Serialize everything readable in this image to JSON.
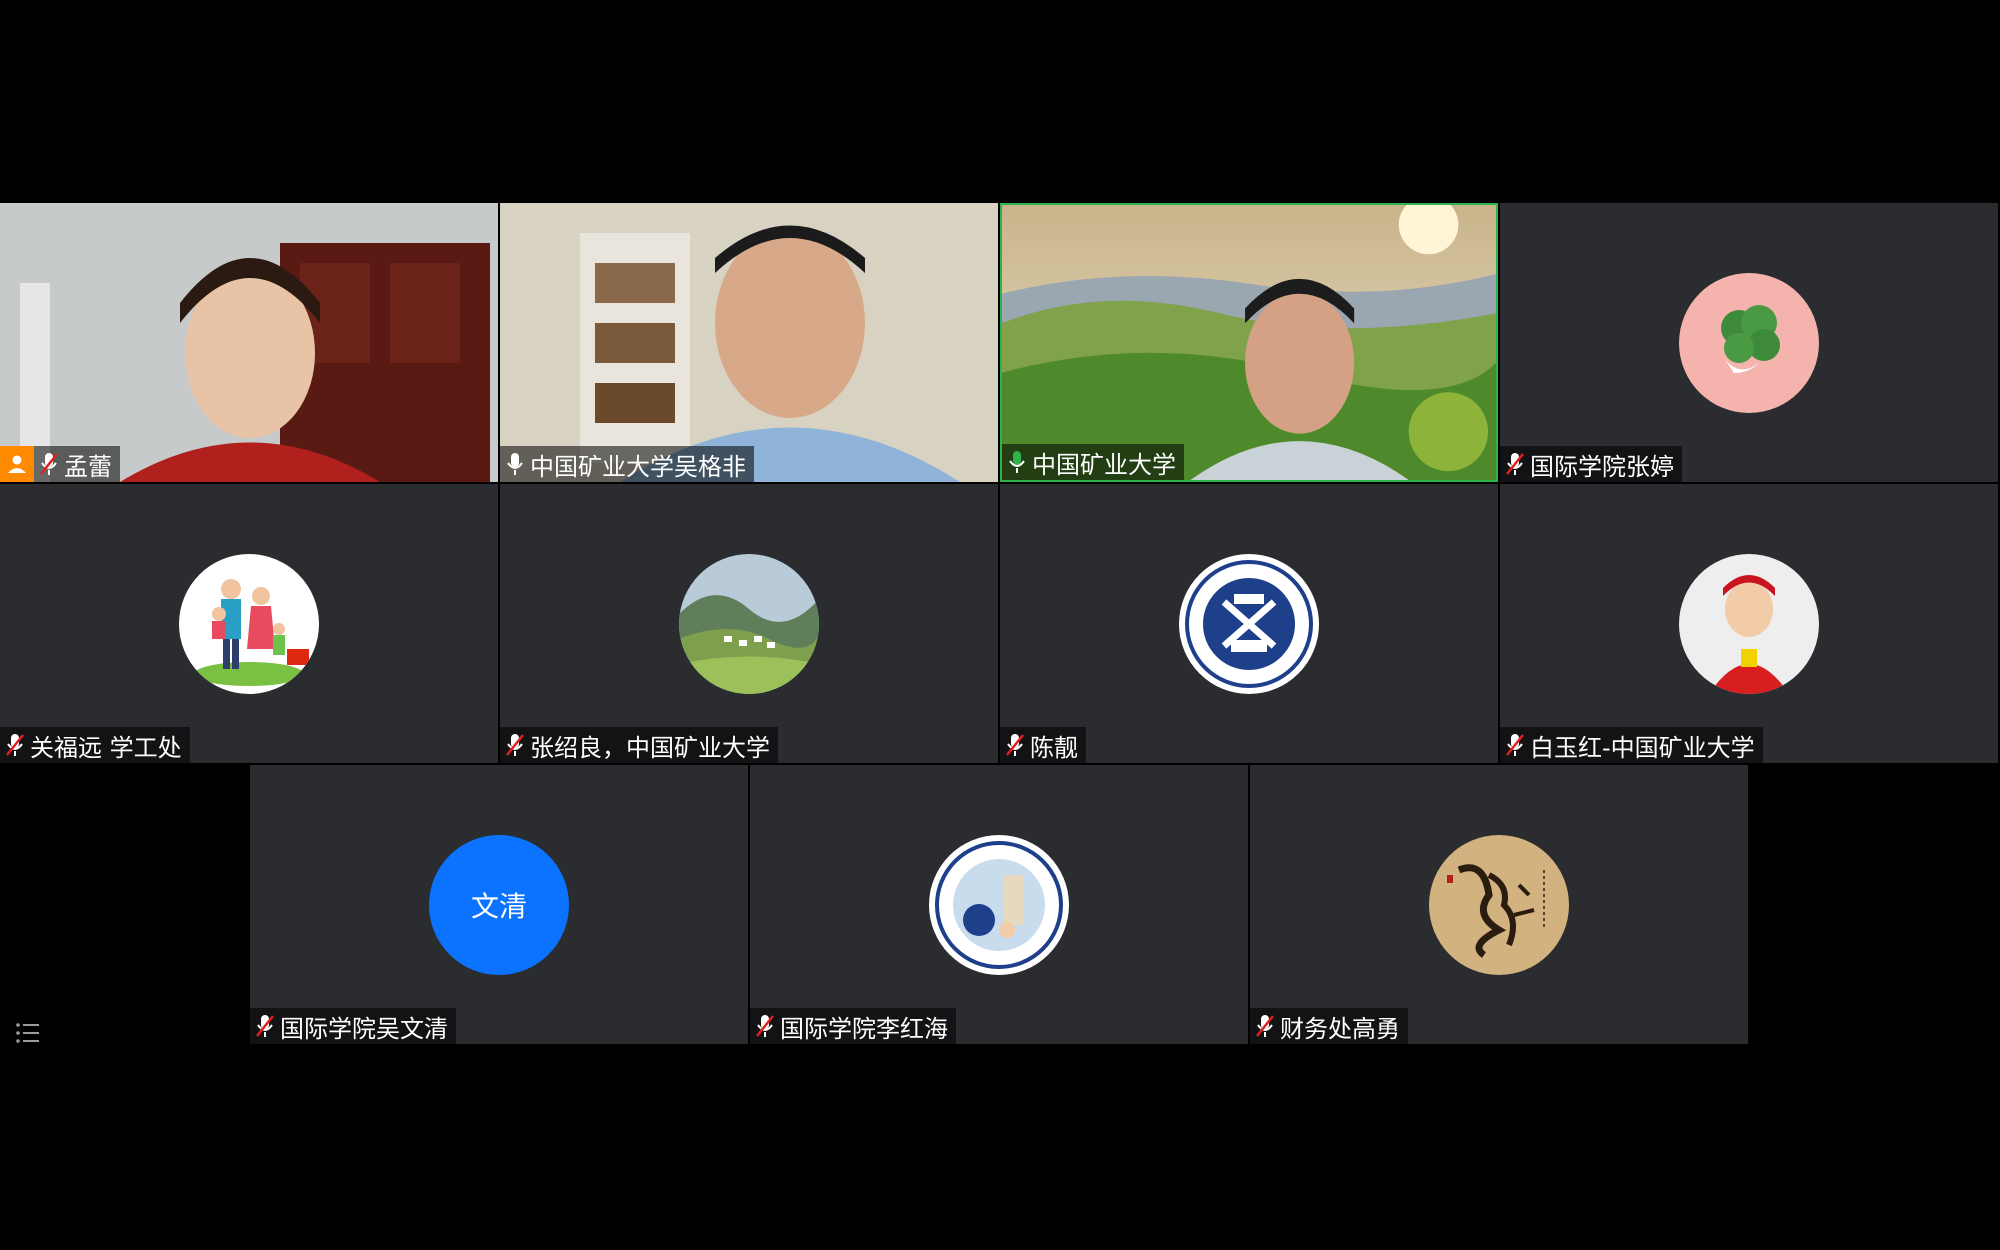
{
  "participants": [
    {
      "name": "孟蕾",
      "mic": "muted",
      "video": "on",
      "host": true
    },
    {
      "name": "中国矿业大学吴格非",
      "mic": "on",
      "video": "on"
    },
    {
      "name": "中国矿业大学",
      "mic": "speaking",
      "video": "on"
    },
    {
      "name": "国际学院张婷",
      "mic": "muted",
      "video": "off",
      "avatar": "flower-avatar"
    },
    {
      "name": "关福远  学工处",
      "mic": "muted",
      "video": "off",
      "avatar": "family-cartoon-avatar"
    },
    {
      "name": "张绍良，中国矿业大学",
      "mic": "muted",
      "video": "off",
      "avatar": "landscape-avatar"
    },
    {
      "name": "陈靓",
      "mic": "muted",
      "video": "off",
      "avatar": "university-seal-avatar"
    },
    {
      "name": "白玉红-中国矿业大学",
      "mic": "muted",
      "video": "off",
      "avatar": "child-photo-avatar"
    },
    {
      "name": "国际学院吴文清",
      "mic": "muted",
      "video": "off",
      "initials": "文清"
    },
    {
      "name": "国际学院李红海",
      "mic": "muted",
      "video": "off",
      "avatar": "university-seal-photo-avatar"
    },
    {
      "name": "财务处高勇",
      "mic": "muted",
      "video": "off",
      "avatar": "calligraphy-avatar"
    }
  ],
  "colors": {
    "tile_bg": "#2b2c2f",
    "active_speaker": "#2fb34a",
    "host_badge": "#ff8a00",
    "muted_icon": "#e02020",
    "initials_bg": "#0b73ff"
  }
}
